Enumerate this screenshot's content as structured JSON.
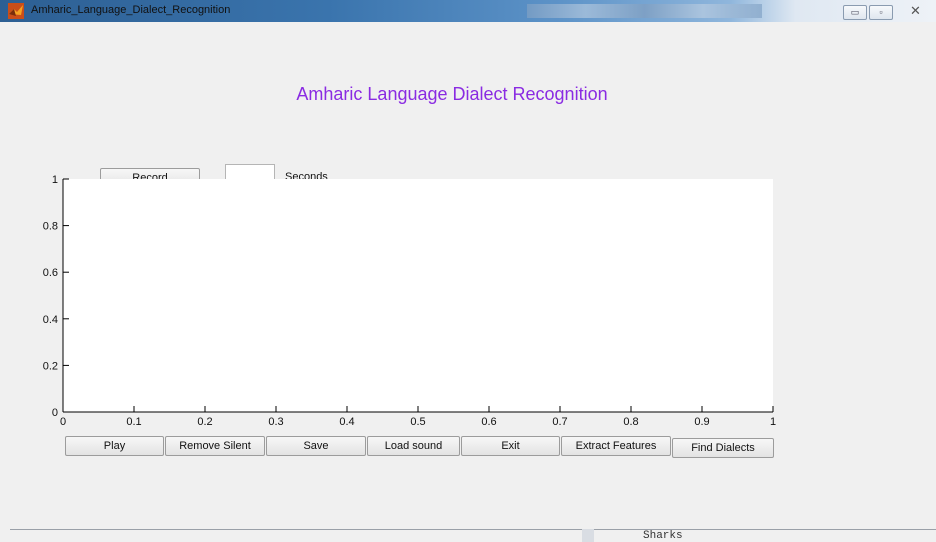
{
  "window": {
    "title": "Amharic_Language_Dialect_Recognition",
    "minimize_icon": "minimize-icon",
    "restore_icon": "restore-icon",
    "close_icon": "close-icon"
  },
  "figure": {
    "heading": "Amharic Language Dialect Recognition",
    "heading_color": "#8a2be2",
    "record_label": "Record",
    "seconds_value": "",
    "seconds_label": "Seconds"
  },
  "chart_data": {
    "type": "line",
    "series": [],
    "xlim": [
      0,
      1
    ],
    "ylim": [
      0,
      1
    ],
    "xticks": [
      "0",
      "0.1",
      "0.2",
      "0.3",
      "0.4",
      "0.5",
      "0.6",
      "0.7",
      "0.8",
      "0.9",
      "1"
    ],
    "yticks": [
      "0",
      "0.2",
      "0.4",
      "0.6",
      "0.8",
      "1"
    ],
    "grid": false
  },
  "buttons": [
    {
      "id": "play",
      "label": "Play"
    },
    {
      "id": "remove-silent",
      "label": "Remove Silent"
    },
    {
      "id": "save",
      "label": "Save"
    },
    {
      "id": "load-sound",
      "label": "Load sound"
    },
    {
      "id": "exit",
      "label": "Exit"
    },
    {
      "id": "extract-features",
      "label": "Extract Features"
    },
    {
      "id": "find-dialects",
      "label": "Find Dialects"
    }
  ],
  "background_window": {
    "text": "Sharks"
  }
}
